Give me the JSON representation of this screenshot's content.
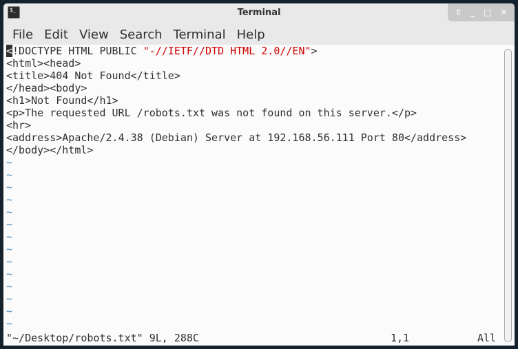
{
  "window": {
    "title": "Terminal"
  },
  "controls": {
    "up": "⇧",
    "minimize": "_",
    "maximize": "□",
    "close": "✕"
  },
  "menu": [
    "File",
    "Edit",
    "View",
    "Search",
    "Terminal",
    "Help"
  ],
  "editor": {
    "line1": {
      "cursor": "<",
      "plain": "!DOCTYPE HTML PUBLIC ",
      "string": "\"-//IETF//DTD HTML 2.0//EN\"",
      "end": ">"
    },
    "lines": [
      "<html><head>",
      "<title>404 Not Found</title>",
      "</head><body>",
      "<h1>Not Found</h1>",
      "<p>The requested URL /robots.txt was not found on this server.</p>",
      "<hr>",
      "<address>Apache/2.4.38 (Debian) Server at 192.168.56.111 Port 80</address>",
      "</body></html>"
    ],
    "tilde": "~",
    "status": {
      "file": "\"~/Desktop/robots.txt\" 9L, 288C",
      "position": "1,1",
      "scroll": "All"
    }
  }
}
